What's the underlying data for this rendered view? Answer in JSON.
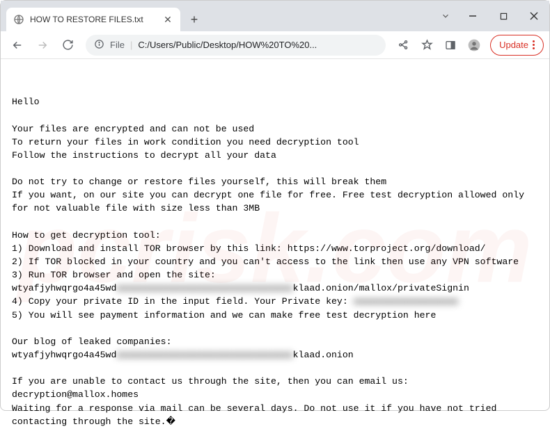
{
  "window": {
    "tab_title": "HOW TO RESTORE FILES.txt",
    "chevron": "⌄",
    "minimize": "—",
    "maximize": "□",
    "close": "✕",
    "newtab": "+",
    "tabclose": "✕"
  },
  "toolbar": {
    "file_label": "File",
    "url_path": "C:/Users/Public/Desktop/HOW%20TO%20...",
    "update_label": "Update"
  },
  "note": {
    "greeting": "Hello",
    "p1_l1": "Your files are encrypted and can not be used",
    "p1_l2": "To return your files in work condition you need decryption tool",
    "p1_l3": "Follow the instructions to decrypt all your data",
    "p2_l1": "Do not try to change or restore files yourself, this will break them",
    "p2_l2": "If you want, on our site you can decrypt one file for free. Free test decryption allowed only for not valuable file with size less than 3MB",
    "howto_title": "How to get decryption tool:",
    "step1": "1) Download and install TOR browser by this link: https://www.torproject.org/download/",
    "step2": "2) If TOR blocked in your country and you can't access to the link then use any VPN software",
    "step3": "3) Run TOR browser and open the site:",
    "onion_prefix1": "wtyafjyhwqrgo4a45wd",
    "onion_blur1": "aaaaaaaaaaaaaaaaaaaaaaaaaaaaaaaa",
    "onion_suffix1": "klaad.onion/mallox/privateSignin",
    "step4_a": "4) Copy your private ID in the input field. Your Private key: ",
    "step4_blur": "aaaaaaaaaaaaaaaaaaa",
    "step5": "5) You will see payment information and we can make free test decryption here",
    "blog_title": "Our blog of leaked companies:",
    "onion_prefix2": "wtyafjyhwqrgo4a45wd",
    "onion_blur2": "aaaaaaaaaaaaaaaaaaaaaaaaaaaaaaaa",
    "onion_suffix2": "klaad.onion",
    "contact_l1": "If you are unable to contact us through the site, then you can email us:",
    "contact_email": "decryption@mallox.homes",
    "contact_l2": "Waiting for a response via mail can be several days. Do not use it if you have not tried contacting through the site.�"
  },
  "watermark": "pcrisk.com"
}
